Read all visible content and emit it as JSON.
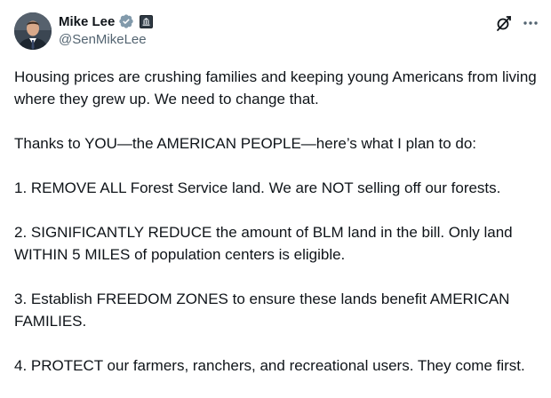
{
  "author": {
    "display_name": "Mike Lee",
    "handle": "@SenMikeLee",
    "verified_color": "#829aab",
    "avatar_icon": "profile-photo"
  },
  "actions": {
    "grok_icon": "grok-icon",
    "more_icon": "more-options-icon"
  },
  "tweet": {
    "paragraphs": [
      "Housing prices are crushing families and keeping young Americans from living where they grew up. We need to change that.",
      "Thanks to YOU—the AMERICAN PEOPLE—here’s what I plan to do:",
      "1. REMOVE ALL Forest Service land. We are NOT selling off our forests.",
      "2. SIGNIFICANTLY REDUCE the amount of BLM land in the bill. Only land WITHIN 5 MILES of population centers is eligible.",
      "3. Establish FREEDOM ZONES to ensure these lands benefit AMERICAN FAMILIES.",
      "4. PROTECT our farmers, ranchers, and recreational users. They come first."
    ]
  }
}
